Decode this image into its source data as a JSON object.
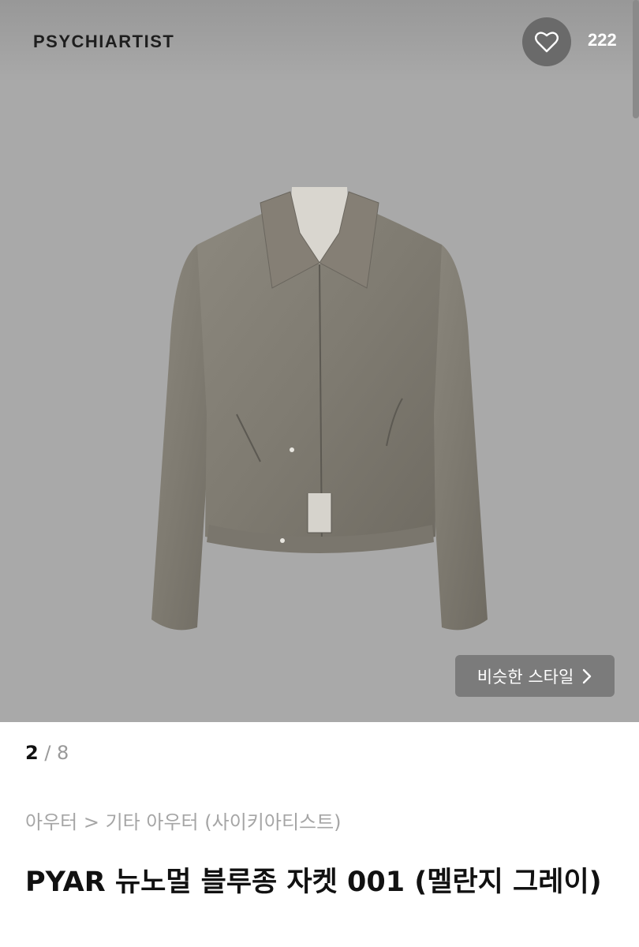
{
  "header": {
    "brand": "PSYCHIARTIST",
    "like_count": "222",
    "like_icon": "heart-outline-icon"
  },
  "product_image": {
    "background_color": "#a9a9a9",
    "similar_style_label": "비슷한 스타일"
  },
  "pager": {
    "current": "2",
    "separator": " / ",
    "total": "8"
  },
  "breadcrumb": "아우터 > 기타 아우터 (사이키아티스트)",
  "product": {
    "title": "PYAR 뉴노멀 블루종 자켓 001 (멜란지 그레이)"
  }
}
